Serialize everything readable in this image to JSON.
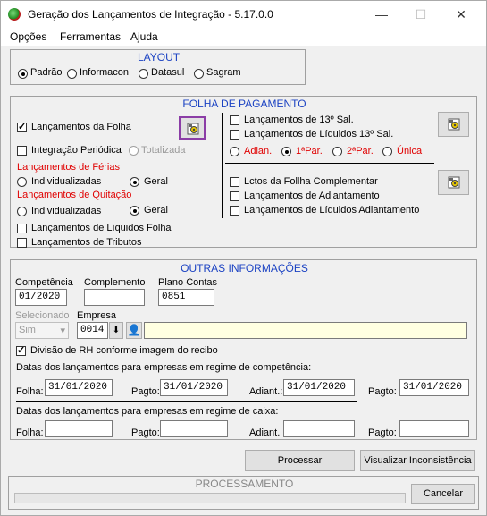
{
  "window": {
    "title": "Geração dos Lançamentos de Integração - 5.17.0.0",
    "minimize": "—",
    "maximize": "☐",
    "close": "✕"
  },
  "menu": {
    "items": [
      "Opções",
      "Ferramentas",
      "Ajuda"
    ]
  },
  "layout": {
    "title": "LAYOUT",
    "options": [
      {
        "label": "Padrão",
        "selected": true
      },
      {
        "label": "Informacon",
        "selected": false
      },
      {
        "label": "Datasul",
        "selected": false
      },
      {
        "label": "Sagram",
        "selected": false
      }
    ]
  },
  "folha": {
    "title": "FOLHA DE PAGAMENTO",
    "lanc_folha": "Lançamentos da Folha",
    "integracao_periodica": "Integração Periódica",
    "totalizada": "Totalizada",
    "ferias_title": "Lançamentos de Férias",
    "ferias_individualizadas": "Individualizadas",
    "ferias_geral": "Geral",
    "quitacao_title": "Lançamentos de Quitação",
    "quit_individualizadas": "Individualizadas",
    "quit_geral": "Geral",
    "liquidos_folha": "Lançamentos de Líquidos Folha",
    "tributos": "Lançamentos de Tributos",
    "lanc_13": "Lançamentos de 13º Sal.",
    "liquidos_13": "Lançamentos de Líquidos 13º Sal.",
    "adian": "Adian.",
    "par1": "1ªPar.",
    "par2": "2ªPar.",
    "unica": "Única",
    "lctos_complementar": "Lctos da Follha Complementar",
    "lanc_adiantamento": "Lançamentos de Adiantamento",
    "liquidos_adiantamento": "Lançamentos de Líquidos Adiantamento"
  },
  "outras": {
    "title": "OUTRAS INFORMAÇÕES",
    "competencia_label": "Competência",
    "competencia_value": "01/2020",
    "complemento_label": "Complemento",
    "complemento_value": "",
    "plano_label": "Plano Contas",
    "plano_value": "0851",
    "selecionado_label": "Selecionado",
    "selecionado_value": "Sim",
    "empresa_label": "Empresa",
    "empresa_value": "0014",
    "empresa_name": "",
    "divisao_rh": "Divisão de RH conforme imagem do recibo",
    "datas_competencia": "Datas dos lançamentos para empresas em regime de competência:",
    "folha_label": "Folha:",
    "pagto_label": "Pagto:",
    "adiant_label": "Adiant.:",
    "pagto2_label": "Pagto:",
    "comp_folha": "31/01/2020",
    "comp_pagto": "31/01/2020",
    "comp_adiant": "31/01/2020",
    "comp_pagto2": "31/01/2020",
    "datas_caixa": "Datas dos lançamentos para empresas em regime de caixa:",
    "caixa_folha_label": "Folha:",
    "caixa_pagto_label": "Pagto:",
    "caixa_adiant_label": "Adiant.",
    "caixa_pagto2_label": "Pagto:"
  },
  "actions": {
    "processar": "Processar",
    "visualizar": "Visualizar Inconsistência"
  },
  "processamento": {
    "title": "PROCESSAMENTO",
    "cancelar": "Cancelar"
  }
}
